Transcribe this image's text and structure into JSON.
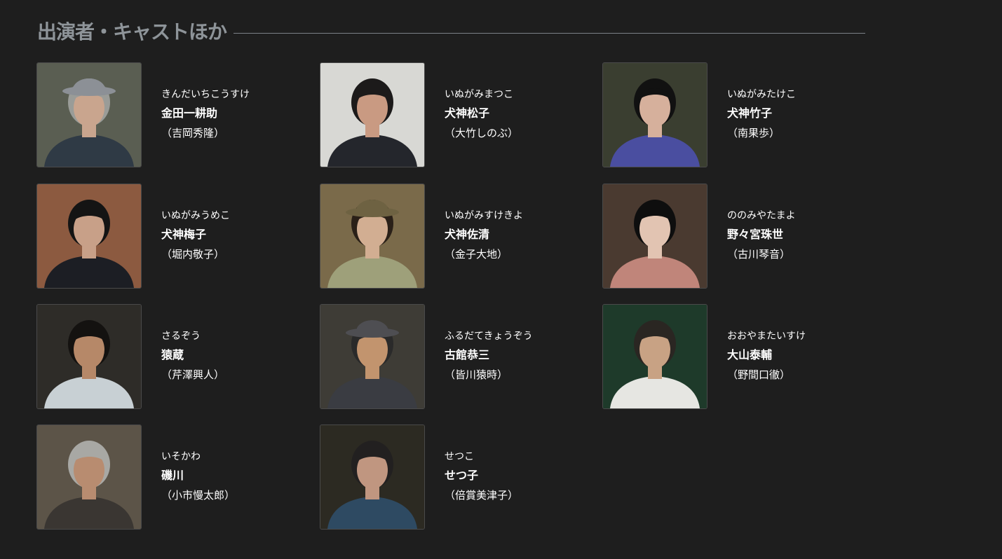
{
  "section": {
    "title": "出演者・キャストほか"
  },
  "cast": [
    {
      "reading": "きんだいちこうすけ",
      "role": "金田一耕助",
      "actor": "（吉岡秀隆）",
      "palette": {
        "bg": "#5a5e52",
        "hair": "#9a9c98",
        "skin": "#c9a58e",
        "clothes": "#2f3a45",
        "hat": "#8c9096"
      }
    },
    {
      "reading": "いぬがみまつこ",
      "role": "犬神松子",
      "actor": "（大竹しのぶ）",
      "palette": {
        "bg": "#d8d8d4",
        "hair": "#1c1a1a",
        "skin": "#c99a82",
        "clothes": "#24262c",
        "hat": ""
      }
    },
    {
      "reading": "いぬがみたけこ",
      "role": "犬神竹子",
      "actor": "（南果歩）",
      "palette": {
        "bg": "#3a3e30",
        "hair": "#111111",
        "skin": "#d6b09c",
        "clothes": "#4a4ea0",
        "hat": ""
      }
    },
    {
      "reading": "いぬがみうめこ",
      "role": "犬神梅子",
      "actor": "（堀内敬子）",
      "palette": {
        "bg": "#8c5a40",
        "hair": "#141414",
        "skin": "#c8a088",
        "clothes": "#1c1e24",
        "hat": ""
      }
    },
    {
      "reading": "いぬがみすけきよ",
      "role": "犬神佐清",
      "actor": "（金子大地）",
      "palette": {
        "bg": "#7a6a4a",
        "hair": "#2a2018",
        "skin": "#d2ae92",
        "clothes": "#9ea07a",
        "hat": "#6e6242"
      }
    },
    {
      "reading": "ののみやたまよ",
      "role": "野々宮珠世",
      "actor": "（古川琴音）",
      "palette": {
        "bg": "#4a3a30",
        "hair": "#0e0e0e",
        "skin": "#e2c4b2",
        "clothes": "#c0857a",
        "hat": ""
      }
    },
    {
      "reading": "さるぞう",
      "role": "猿蔵",
      "actor": "（芹澤興人）",
      "palette": {
        "bg": "#2e2c28",
        "hair": "#141210",
        "skin": "#b68868",
        "clothes": "#c8d0d4",
        "hat": ""
      }
    },
    {
      "reading": "ふるだてきょうぞう",
      "role": "古館恭三",
      "actor": "（皆川猿時）",
      "palette": {
        "bg": "#3e3c36",
        "hair": "#2a2a2a",
        "skin": "#c2946e",
        "clothes": "#3a3c42",
        "hat": "#4e4e52"
      }
    },
    {
      "reading": "おおやまたいすけ",
      "role": "大山泰輔",
      "actor": "（野間口徹）",
      "palette": {
        "bg": "#1e3a2a",
        "hair": "#2a2622",
        "skin": "#c8a284",
        "clothes": "#e6e6e2",
        "hat": ""
      }
    },
    {
      "reading": "いそかわ",
      "role": "磯川",
      "actor": "（小市慢太郎）",
      "palette": {
        "bg": "#5c5448",
        "hair": "#a8a8a4",
        "skin": "#b88c70",
        "clothes": "#3a3632",
        "hat": ""
      }
    },
    {
      "reading": "せつこ",
      "role": "せつ子",
      "actor": "（倍賞美津子）",
      "palette": {
        "bg": "#2c2a22",
        "hair": "#222020",
        "skin": "#c09680",
        "clothes": "#2e4a62",
        "hat": ""
      }
    }
  ]
}
